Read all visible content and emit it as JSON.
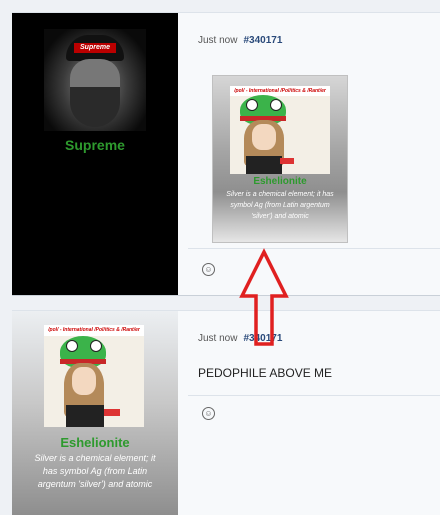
{
  "posts": [
    {
      "author": "Supreme",
      "avatar_text": "Supreme",
      "timestamp": "Just now",
      "post_id": "#340171",
      "message": "",
      "signature": {
        "header": "/pol/ - International /Pol/itics & /Rant/er",
        "name": "Eshelionite",
        "text": "Silver is a chemical element; it has symbol Ag (from Latin argentum 'silver') and atomic"
      },
      "reaction_icon": "smiley-icon"
    },
    {
      "author": "Eshelionite",
      "timestamp": "Just now",
      "post_id": "#340171",
      "message": "PEDOPHILE ABOVE ME",
      "signature": {
        "header": "/pol/ - International /Pol/itics & /Rant/er",
        "name": "Eshelionite",
        "text": "Silver is a chemical element; it has symbol Ag (from Latin argentum 'silver') and atomic"
      },
      "reaction_icon": "smiley-icon"
    }
  ],
  "annotation": {
    "type": "red-arrow-up",
    "color": "#e02020"
  }
}
